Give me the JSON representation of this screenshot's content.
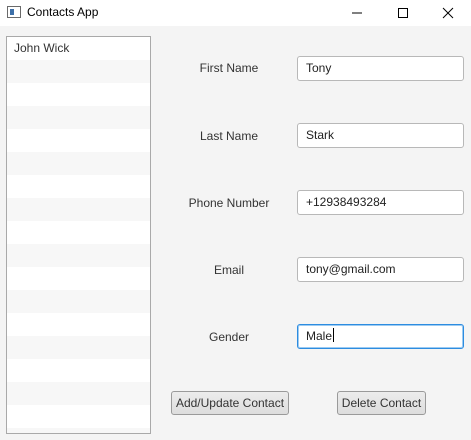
{
  "window": {
    "title": "Contacts App",
    "icon": "app-window-icon",
    "controls": [
      "minimize-icon",
      "maximize-icon",
      "close-icon"
    ]
  },
  "contacts": {
    "items": [
      "John Wick"
    ]
  },
  "form": {
    "first_name": {
      "label": "First Name",
      "value": "Tony"
    },
    "last_name": {
      "label": "Last Name",
      "value": "Stark"
    },
    "phone": {
      "label": "Phone Number",
      "value": "+12938493284"
    },
    "email": {
      "label": "Email",
      "value": "tony@gmail.com"
    },
    "gender": {
      "label": "Gender",
      "value": "Male"
    }
  },
  "actions": {
    "add_update_label": "Add/Update Contact",
    "delete_label": "Delete Contact"
  },
  "colors": {
    "focus_border": "#2d8ce0",
    "background": "#f4f4f4"
  }
}
